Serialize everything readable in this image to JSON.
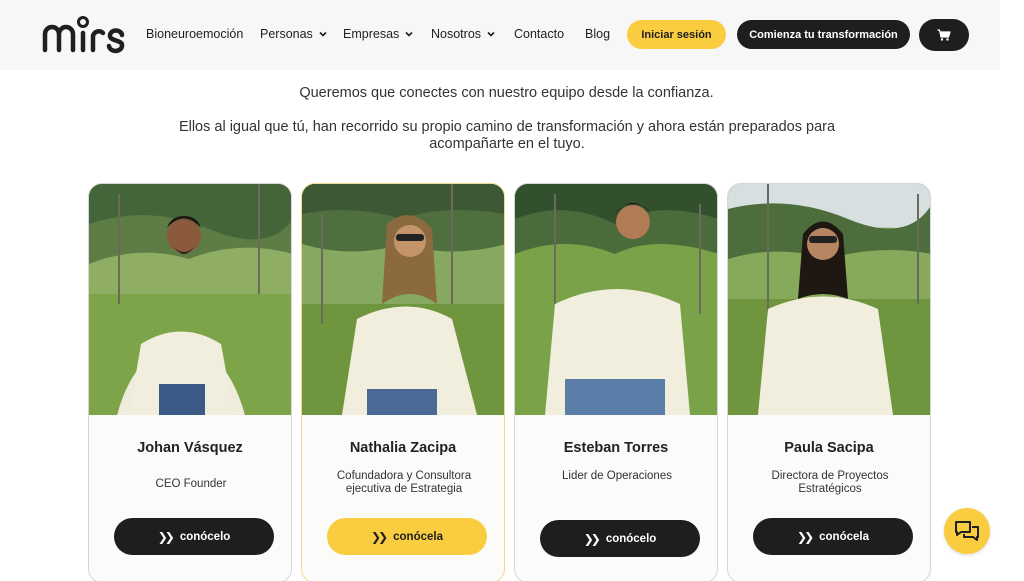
{
  "header": {
    "logo_text": "mirs",
    "nav": [
      {
        "label": "Bioneuroemoción",
        "dropdown": false
      },
      {
        "label": "Personas",
        "dropdown": true
      },
      {
        "label": "Empresas",
        "dropdown": true
      },
      {
        "label": "Nosotros",
        "dropdown": true
      },
      {
        "label": "Contacto",
        "dropdown": false
      },
      {
        "label": "Blog",
        "dropdown": false
      }
    ],
    "login_label": "Iniciar sesión",
    "transform_label": "Comienza tu transformación",
    "cart_icon": "cart-icon"
  },
  "intro": {
    "line1": "Queremos que conectes con nuestro equipo desde la confianza.",
    "line2": "Ellos al igual que tú, han recorrido su propio camino de transformación y ahora están preparados para acompañarte en el tuyo."
  },
  "team": [
    {
      "name": "Johan Vásquez",
      "role": "CEO Founder",
      "cta": "conócelo",
      "cta_style": "dark"
    },
    {
      "name": "Nathalia Zacipa",
      "role": "Cofundadora y Consultora ejecutiva de Estrategia",
      "cta": "conócela",
      "cta_style": "yellow"
    },
    {
      "name": "Esteban Torres",
      "role": "Lider de Operaciones",
      "cta": "conócelo",
      "cta_style": "dark"
    },
    {
      "name": "Paula Sacipa",
      "role": "Directora de Proyectos Estratégicos",
      "cta": "conócela",
      "cta_style": "dark"
    }
  ],
  "colors": {
    "accent_yellow": "#f9cd3f",
    "dark": "#1c1e1f",
    "header_bg": "#f6f7f6",
    "grass": "#7aa340",
    "hoodie": "#f2eedd"
  },
  "chat_icon": "chat-bubble-icon"
}
